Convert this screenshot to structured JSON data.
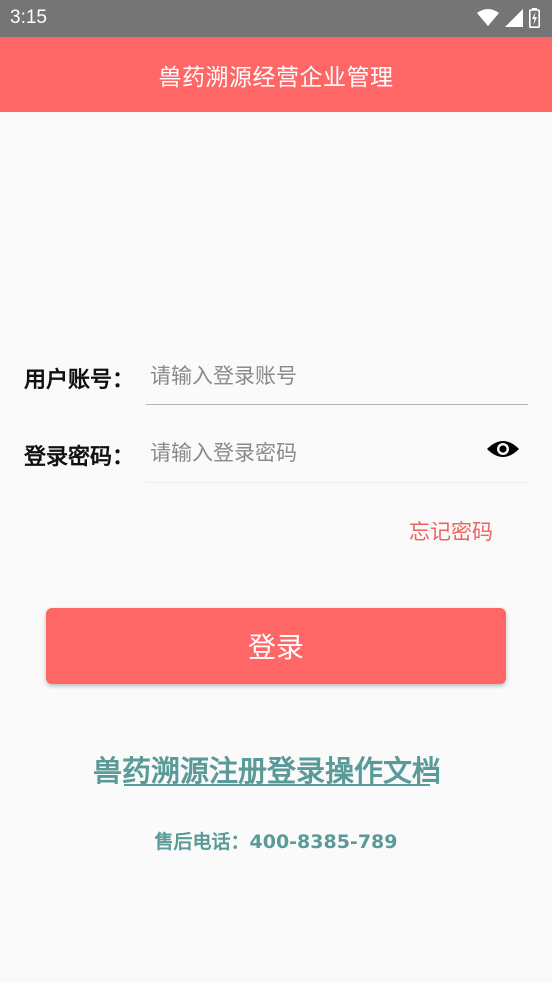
{
  "status_bar": {
    "time": "3:15"
  },
  "app_bar": {
    "title": "兽药溯源经营企业管理"
  },
  "form": {
    "account_label": "用户账号：",
    "account_placeholder": "请输入登录账号",
    "account_value": "",
    "password_label": "登录密码：",
    "password_placeholder": "请输入登录密码",
    "password_value": ""
  },
  "forgot_password": "忘记密码",
  "login_button": "登录",
  "doc_link": "兽药溯源注册登录操作文档",
  "service_phone": "售后电话：400-8385-789",
  "colors": {
    "primary": "#ff6666",
    "link_teal": "#5a9a98",
    "forgot_red": "#f0625e",
    "status_bar": "#757575"
  },
  "icons": [
    "wifi-icon",
    "signal-icon",
    "battery-icon",
    "eye-icon"
  ]
}
